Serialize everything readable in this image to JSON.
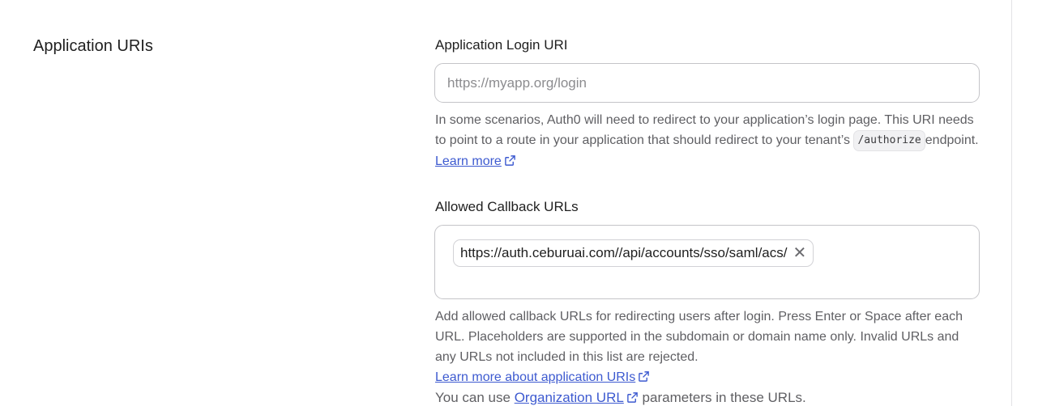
{
  "section": {
    "title": "Application URIs"
  },
  "login_uri": {
    "label": "Application Login URI",
    "placeholder": "https://myapp.org/login",
    "value": "",
    "help_part1": "In some scenarios, Auth0 will need to redirect to your application’s login page. This URI needs to point to a route in your application that should redirect to your tenant’s",
    "code": "/authorize",
    "help_part2": "endpoint.",
    "learn_more": "Learn more"
  },
  "callback_urls": {
    "label": "Allowed Callback URLs",
    "tags": [
      "https://auth.ceburuai.com//api/accounts/sso/saml/acs/"
    ],
    "remove_glyph": "✕",
    "help": "Add allowed callback URLs for redirecting users after login. Press Enter or Space after each URL. Placeholders are supported in the subdomain or domain name only. Invalid URLs and any URLs not included in this list are rejected.",
    "learn_more": "Learn more about application URIs",
    "org_prefix": "You can use",
    "org_link": "Organization URL",
    "org_suffix": "parameters in these URLs."
  },
  "colors": {
    "link": "#3d5ad0",
    "border": "#c4c4c8",
    "help_text": "#5f5f63"
  },
  "icons": {
    "external": "external-link-icon",
    "remove": "close-icon"
  }
}
